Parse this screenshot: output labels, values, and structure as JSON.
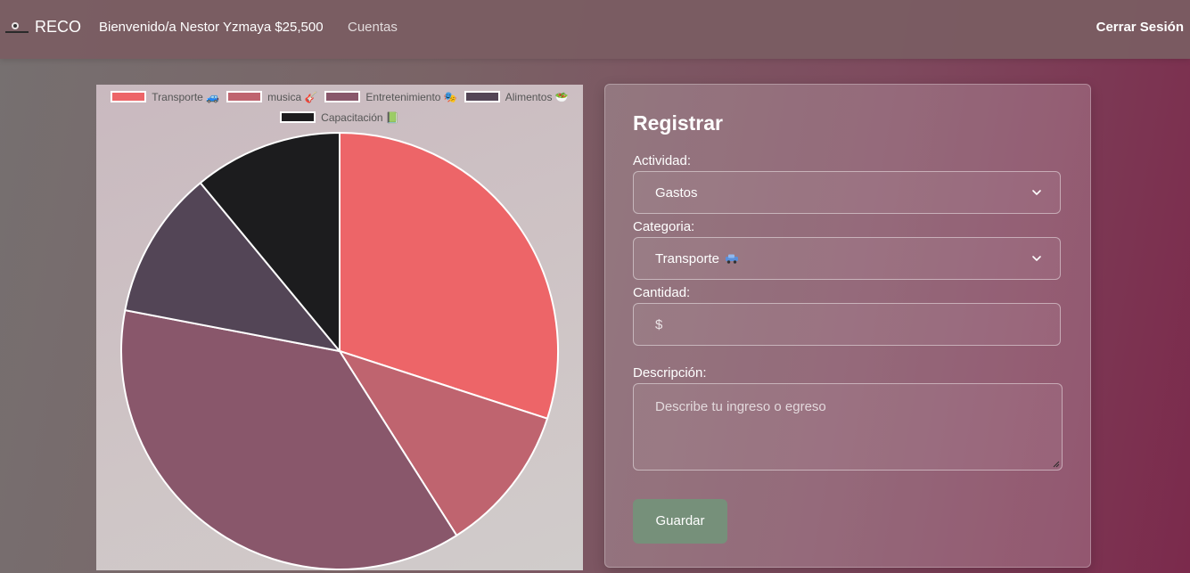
{
  "navbar": {
    "brand": "RECO",
    "welcome": "Bienvenido/a Nestor Yzmaya $25,500",
    "link_cuentas": "Cuentas",
    "logout": "Cerrar Sesión"
  },
  "chart_data": {
    "type": "pie",
    "legend_position": "top",
    "categories": [
      "Transporte 🚙",
      "musica 🎸",
      "Entretenimiento 🎭",
      "Alimentos 🥗",
      "Capacitación 📗"
    ],
    "values": [
      30,
      11,
      37,
      11,
      11
    ],
    "colors": [
      "#ed6568",
      "#bf646f",
      "#89576b",
      "#534556",
      "#1c1c1e"
    ]
  },
  "form": {
    "title": "Registrar",
    "actividad_label": "Actividad:",
    "actividad_value": "Gastos",
    "categoria_label": "Categoria:",
    "categoria_value": "Transporte",
    "categoria_icon": "car-emoji-icon",
    "cantidad_label": "Cantidad:",
    "cantidad_placeholder": "$",
    "descripcion_label": "Descripción:",
    "descripcion_placeholder": "Describe tu ingreso o egreso",
    "save_label": "Guardar",
    "save_color": "#76907a"
  }
}
